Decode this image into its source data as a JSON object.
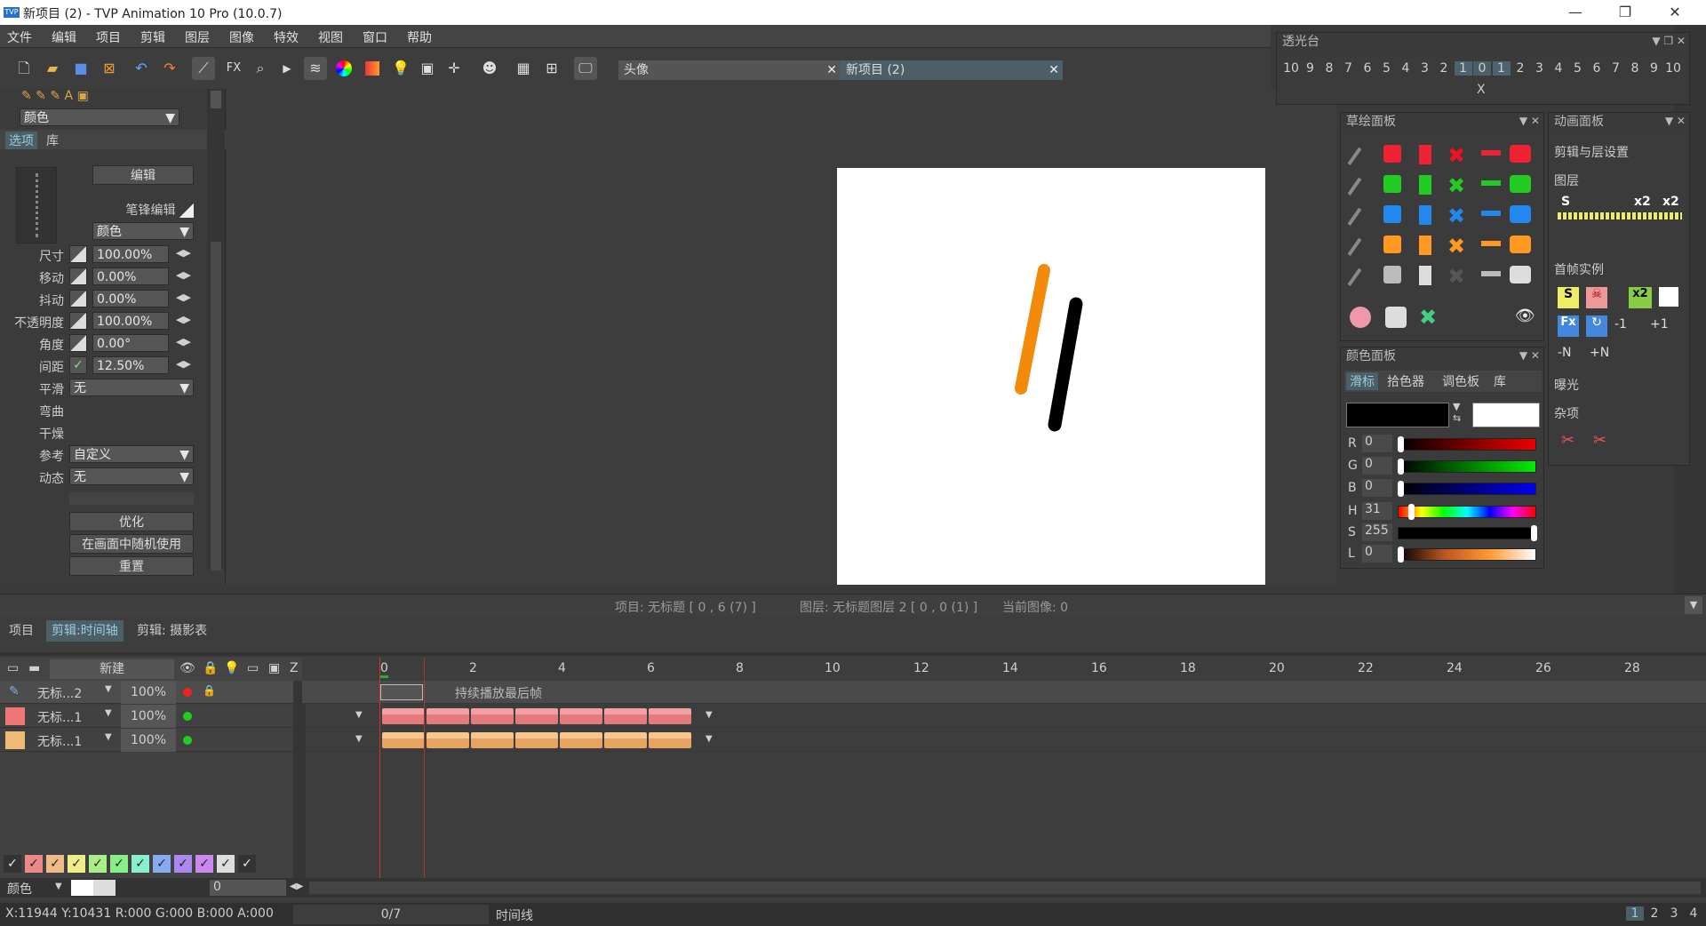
{
  "window": {
    "title": "新项目 (2) - TVP Animation 10 Pro (10.0.7)",
    "logo": "TVP"
  },
  "menu": [
    "文件",
    "编辑",
    "项目",
    "剪辑",
    "图层",
    "图像",
    "特效",
    "视图",
    "窗口",
    "帮助"
  ],
  "toolbar": {
    "fx_label": "FX",
    "tab1": "头像",
    "tab2": "新项目 (2)",
    "close": "✕"
  },
  "left": {
    "color_select": "颜色",
    "tabs": [
      "选项",
      "库"
    ],
    "edit_btn": "编辑",
    "pen_edit": "笔锋编辑",
    "color2": "颜色",
    "rows": [
      {
        "label": "尺寸",
        "value": "100.00%"
      },
      {
        "label": "移动",
        "value": "0.00%"
      },
      {
        "label": "抖动",
        "value": "0.00%"
      },
      {
        "label": "不透明度",
        "value": "100.00%"
      },
      {
        "label": "角度",
        "value": "0.00°"
      },
      {
        "label": "间距",
        "value": "12.50%"
      }
    ],
    "smooth_label": "平滑",
    "smooth_value": "无",
    "bend": "弯曲",
    "dry": "干燥",
    "ref_label": "参考",
    "ref_value": "自定义",
    "dyn_label": "动态",
    "dyn_value": "无",
    "optimize": "优化",
    "random": "在画面中随机使用",
    "reset": "重置"
  },
  "lightbox": {
    "title": "透光台",
    "nums": [
      "10",
      "9",
      "8",
      "7",
      "6",
      "5",
      "4",
      "3",
      "2",
      "1",
      "0",
      "1",
      "2",
      "3",
      "4",
      "5",
      "6",
      "7",
      "8",
      "9",
      "10"
    ],
    "x": "X"
  },
  "sketch": {
    "title": "草绘面板"
  },
  "color": {
    "title": "颜色面板",
    "tabs": [
      "滑标",
      "拾色器",
      "调色板",
      "库"
    ],
    "sliders": [
      {
        "k": "R",
        "v": "0"
      },
      {
        "k": "G",
        "v": "0"
      },
      {
        "k": "B",
        "v": "0"
      },
      {
        "k": "H",
        "v": "31"
      },
      {
        "k": "S",
        "v": "255"
      },
      {
        "k": "L",
        "v": "0"
      }
    ]
  },
  "anim": {
    "title": "动画面板",
    "s1": "剪辑与层设置",
    "s2": "图层",
    "s3": "首帧实例",
    "s4": "曝光",
    "s5": "杂项",
    "x2": "x2",
    "S": "S",
    "Fx": "Fx",
    "p1": "+1",
    "m1": "-1",
    "n1": "-N",
    "n2": "+N"
  },
  "status": {
    "project": "项目: 无标题 [ 0 , 6  (7) ]",
    "layer": "图层: 无标题图层 2 [ 0 , 0  (1) ]",
    "image": "当前图像: 0"
  },
  "timeline": {
    "tabs": [
      "项目",
      "剪辑:时间轴",
      "剪辑: 摄影表"
    ],
    "new_label": "新建",
    "z": "Z",
    "ruler": [
      "0",
      "2",
      "4",
      "6",
      "8",
      "10",
      "12",
      "14",
      "16",
      "18",
      "20",
      "22",
      "24",
      "26",
      "28"
    ],
    "layers": [
      {
        "name": "无标...2",
        "opacity": "100%"
      },
      {
        "name": "无标...1",
        "opacity": "100%"
      },
      {
        "name": "无标...1",
        "opacity": "100%"
      }
    ],
    "hold_text": "持续播放最后帧",
    "color_label": "颜色",
    "frame_value": "0"
  },
  "bottom": {
    "coords": "X:11944  Y:10431  R:000 G:000 B:000 A:000",
    "frames": "0/7",
    "timeline": "时间线",
    "pages": [
      "1",
      "2",
      "3",
      "4"
    ]
  }
}
